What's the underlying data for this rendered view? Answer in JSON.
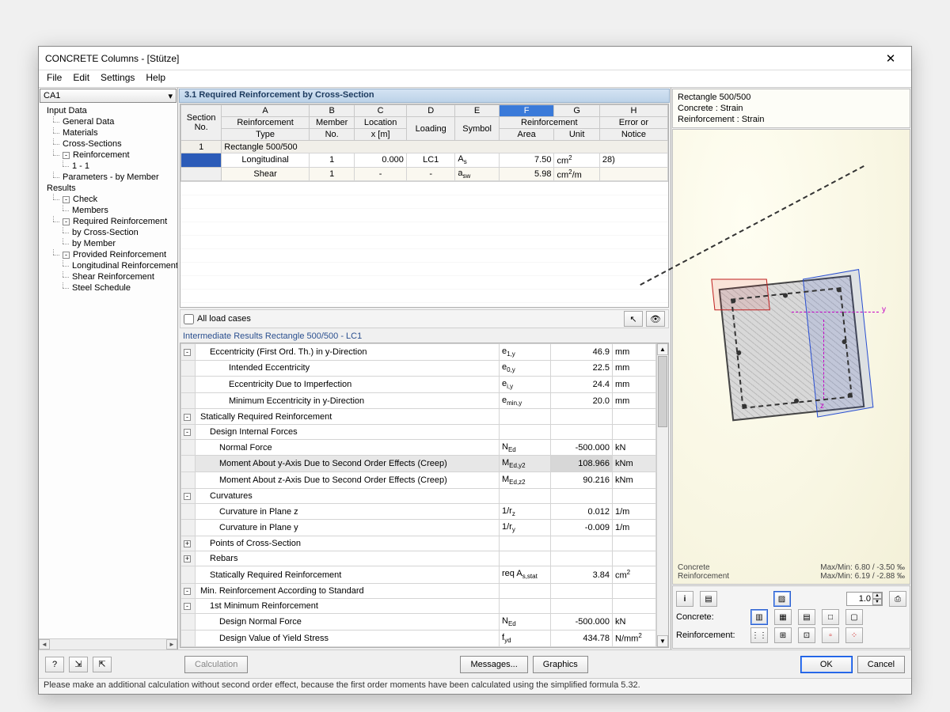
{
  "title": "CONCRETE Columns - [Stütze]",
  "menu": {
    "file": "File",
    "edit": "Edit",
    "settings": "Settings",
    "help": "Help"
  },
  "combo": {
    "value": "CA1"
  },
  "nav": {
    "inputData": "Input Data",
    "generalData": "General Data",
    "materials": "Materials",
    "crossSections": "Cross-Sections",
    "reinforcement": "Reinforcement",
    "oneOne": "1 - 1",
    "paramsByMember": "Parameters - by Member",
    "results": "Results",
    "check": "Check",
    "members": "Members",
    "requiredReinf": "Required Reinforcement",
    "byCrossSection": "by Cross-Section",
    "byMember": "by Member",
    "providedReinf": "Provided Reinforcement",
    "longitudinal": "Longitudinal Reinforcement",
    "shearReinf": "Shear Reinforcement",
    "steelSchedule": "Steel Schedule"
  },
  "panelTitle": "3.1 Required Reinforcement by Cross-Section",
  "grid": {
    "letters": {
      "A": "A",
      "B": "B",
      "C": "C",
      "D": "D",
      "E": "E",
      "F": "F",
      "G": "G",
      "H": "H"
    },
    "head": {
      "sectionNo1": "Section",
      "sectionNo2": "No.",
      "reinfType1": "Reinforcement",
      "reinfType2": "Type",
      "member1": "Member",
      "member2": "No.",
      "loc1": "Location",
      "loc2": "x [m]",
      "loading": "Loading",
      "symbol": "Symbol",
      "reinfSpan": "Reinforcement",
      "area": "Area",
      "unit": "Unit",
      "error1": "Error or",
      "error2": "Notice"
    },
    "sectionRow": {
      "no": "1",
      "label": "Rectangle 500/500"
    },
    "rows": [
      {
        "type": "Longitudinal",
        "member": "1",
        "x": "0.000",
        "loading": "LC1",
        "symbol": "A",
        "sub": "s",
        "area": "7.50",
        "unit": "cm",
        "unitSup": "2",
        "note": "28)"
      },
      {
        "type": "Shear",
        "member": "1",
        "x": "-",
        "loading": "-",
        "symbol": "a",
        "sub": "sw",
        "area": "5.98",
        "unit": "cm",
        "unitSup": "2",
        "unitSuffix": "/m",
        "note": ""
      }
    ],
    "allLoadCases": "All load cases"
  },
  "intermTitle": "Intermediate Results Rectangle 500/500 - LC1",
  "interm": [
    {
      "exp": "-",
      "ind": 1,
      "label": "Eccentricity (First Ord. Th.) in y-Direction",
      "sym": "e",
      "sub": "1,y",
      "val": "46.9",
      "unit": "mm"
    },
    {
      "exp": "",
      "ind": 3,
      "label": "Intended Eccentricity",
      "sym": "e",
      "sub": "0,y",
      "val": "22.5",
      "unit": "mm"
    },
    {
      "exp": "",
      "ind": 3,
      "label": "Eccentricity Due to Imperfection",
      "sym": "e",
      "sub": "i,y",
      "val": "24.4",
      "unit": "mm"
    },
    {
      "exp": "",
      "ind": 3,
      "label": "Minimum Eccentricity in y-Direction",
      "sym": "e",
      "sub": "min,y",
      "val": "20.0",
      "unit": "mm"
    },
    {
      "exp": "-",
      "ind": 0,
      "label": "Statically Required Reinforcement",
      "sym": "",
      "sub": "",
      "val": "",
      "unit": ""
    },
    {
      "exp": "-",
      "ind": 1,
      "label": "Design Internal Forces",
      "sym": "",
      "sub": "",
      "val": "",
      "unit": ""
    },
    {
      "exp": "",
      "ind": 2,
      "label": "Normal Force",
      "sym": "N",
      "sub": "Ed",
      "val": "-500.000",
      "unit": "kN"
    },
    {
      "exp": "",
      "ind": 2,
      "label": "Moment About y-Axis Due to Second Order Effects (Creep)",
      "sym": "M",
      "sub": "Ed,y2",
      "val": "108.966",
      "unit": "kNm",
      "sel": true
    },
    {
      "exp": "",
      "ind": 2,
      "label": "Moment About z-Axis Due to Second Order Effects (Creep)",
      "sym": "M",
      "sub": "Ed,z2",
      "val": "90.216",
      "unit": "kNm"
    },
    {
      "exp": "-",
      "ind": 1,
      "label": "Curvatures",
      "sym": "",
      "sub": "",
      "val": "",
      "unit": ""
    },
    {
      "exp": "",
      "ind": 2,
      "label": "Curvature in Plane z",
      "sym": "1/r",
      "sub": "z",
      "val": "0.012",
      "unit": "1/m"
    },
    {
      "exp": "",
      "ind": 2,
      "label": "Curvature in Plane y",
      "sym": "1/r",
      "sub": "y",
      "val": "-0.009",
      "unit": "1/m"
    },
    {
      "exp": "+",
      "ind": 1,
      "label": "Points of Cross-Section",
      "sym": "",
      "sub": "",
      "val": "",
      "unit": ""
    },
    {
      "exp": "+",
      "ind": 1,
      "label": "Rebars",
      "sym": "",
      "sub": "",
      "val": "",
      "unit": ""
    },
    {
      "exp": "",
      "ind": 1,
      "label": "Statically Required Reinforcement",
      "sym": "req A",
      "sub": "s,stat",
      "val": "3.84",
      "unit": "cm",
      "unitSup": "2"
    },
    {
      "exp": "-",
      "ind": 0,
      "label": "Min. Reinforcement According to Standard",
      "sym": "",
      "sub": "",
      "val": "",
      "unit": ""
    },
    {
      "exp": "-",
      "ind": 1,
      "label": "1st Minimum Reinforcement",
      "sym": "",
      "sub": "",
      "val": "",
      "unit": ""
    },
    {
      "exp": "",
      "ind": 2,
      "label": "Design Normal Force",
      "sym": "N",
      "sub": "Ed",
      "val": "-500.000",
      "unit": "kN"
    },
    {
      "exp": "",
      "ind": 2,
      "label": "Design Value of Yield Stress",
      "sym": "f",
      "sub": "yd",
      "val": "434.78",
      "unit": "N/mm",
      "unitSup": "2"
    }
  ],
  "right": {
    "line1": "Rectangle 500/500",
    "line2": "Concrete : Strain",
    "line3": "Reinforcement : Strain",
    "concrete": "Concrete",
    "reinf": "Reinforcement",
    "concreteStat": "Max/Min: 6.80 / -3.50 ‰",
    "reinfStat": "Max/Min: 6.19 / -2.88 ‰",
    "concreteLabel": "Concrete:",
    "reinfLabel": "Reinforcement:",
    "spin": "1.0",
    "axisY": "y",
    "axisZ": "z"
  },
  "bottom": {
    "calculation": "Calculation",
    "messages": "Messages...",
    "graphics": "Graphics",
    "ok": "OK",
    "cancel": "Cancel"
  },
  "status": "Please make an additional calculation without second order effect, because the first order moments have been calculated using the simplified formula 5.32."
}
